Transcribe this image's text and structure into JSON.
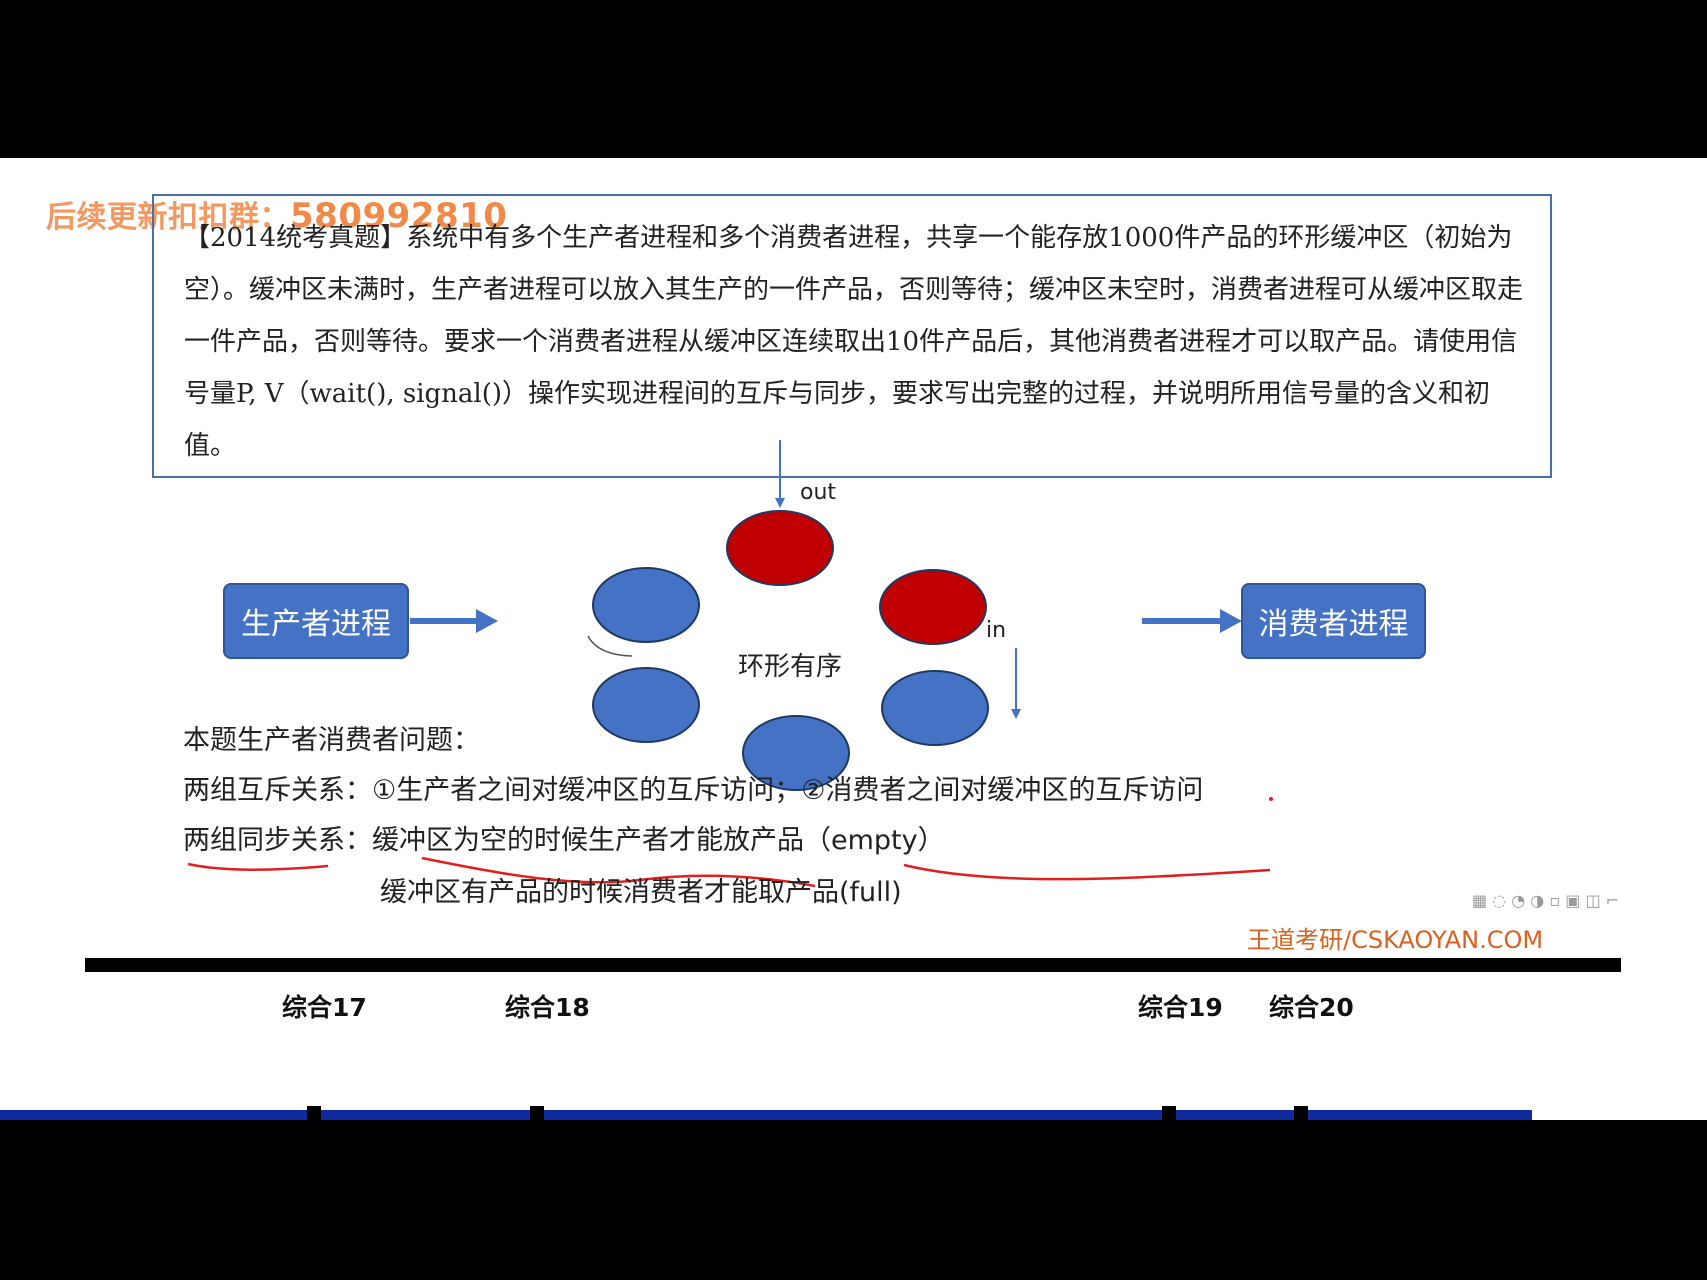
{
  "watermark": {
    "prefix": "后续更新扣扣群：",
    "number": "580992810"
  },
  "question": {
    "text": "【2014统考真题】系统中有多个生产者进程和多个消费者进程，共享一个能存放1000件产品的环形缓冲区（初始为空）。缓冲区未满时，生产者进程可以放入其生产的一件产品，否则等待；缓冲区未空时，消费者进程可从缓冲区取走一件产品，否则等待。要求一个消费者进程从缓冲区连续取出10件产品后，其他消费者进程才可以取产品。请使用信号量P, V（wait(), signal()）操作实现进程间的互斥与同步，要求写出完整的过程，并说明所用信号量的含义和初值。"
  },
  "diagram": {
    "producer_label": "生产者进程",
    "consumer_label": "消费者进程",
    "ring_label": "环形有序",
    "out_label": "out",
    "in_label": "in",
    "colors": {
      "full_slot": "#c00000",
      "empty_slot": "#4472c4",
      "box": "#4472c4",
      "annotation": "#e02020"
    }
  },
  "analysis": {
    "heading": "本题生产者消费者问题：",
    "mutex_line": "两组互斥关系：①生产者之间对缓冲区的互斥访问；②消费者之间对缓冲区的互斥访问",
    "sync_line_1": "两组同步关系：缓冲区为空的时候生产者才能放产品（empty）",
    "sync_line_2": "缓冲区有产品的时候消费者才能取产品(full)"
  },
  "brand": "王道考研/CSKAOYAN.COM",
  "timeline": {
    "labels": [
      "综合17",
      "综合18",
      "综合19",
      "综合20"
    ]
  }
}
